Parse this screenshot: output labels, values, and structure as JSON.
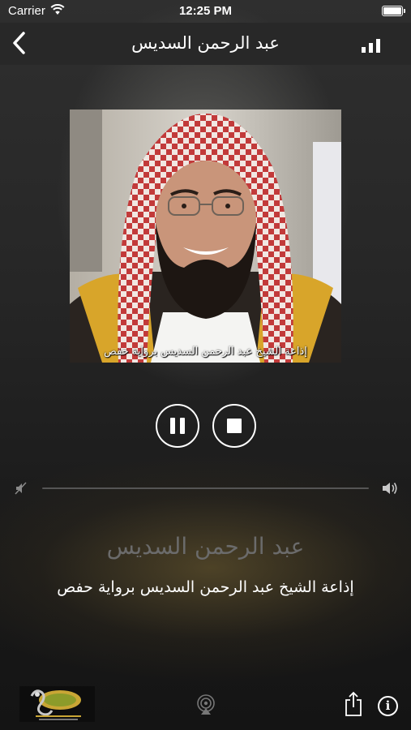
{
  "status_bar": {
    "carrier": "Carrier",
    "time": "12:25 PM",
    "wifi_icon": "wifi-icon",
    "battery_icon": "battery-icon"
  },
  "nav": {
    "title": "عبد الرحمن السديس",
    "back_icon": "chevron-left-icon",
    "signal_icon": "signal-bars-icon"
  },
  "artwork": {
    "caption": "إذاعة الشيخ عبد الرحمن السديس برواية حفص"
  },
  "controls": {
    "pause_icon": "pause-icon",
    "stop_icon": "stop-icon"
  },
  "volume": {
    "min_icon": "volume-mute-icon",
    "max_icon": "volume-high-icon",
    "level": 0
  },
  "now_playing": {
    "station_name": "عبد الرحمن السديس",
    "description": "إذاعة الشيخ عبد الرحمن السديس برواية حفص"
  },
  "bottom_bar": {
    "logo_icon": "quran-radio-logo",
    "airplay_icon": "airplay-icon",
    "share_icon": "share-icon",
    "info_icon": "info-icon",
    "info_glyph": "i"
  },
  "colors": {
    "nav_background": "#282828",
    "station_name": "#6b6b6b",
    "text": "#ffffff"
  }
}
